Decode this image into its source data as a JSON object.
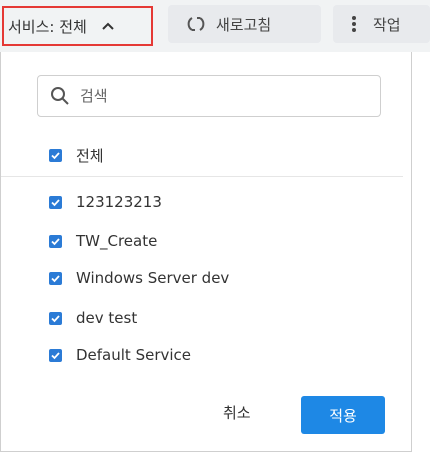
{
  "toolbar": {
    "service_filter_label": "서비스: 전체",
    "refresh_label": "새로고침",
    "actions_label": "작업"
  },
  "dropdown": {
    "search_placeholder": "검색",
    "select_all_label": "전체",
    "options": [
      {
        "label": "123123213",
        "checked": true
      },
      {
        "label": "TW_Create",
        "checked": true
      },
      {
        "label": "Windows Server dev",
        "checked": true
      },
      {
        "label": "dev test",
        "checked": true
      },
      {
        "label": "Default Service",
        "checked": true
      }
    ],
    "cancel_label": "취소",
    "apply_label": "적용"
  },
  "colors": {
    "accent": "#1e88e5",
    "checkbox": "#2b7bd6",
    "highlight_border": "#e53935"
  },
  "icons": [
    "chevron-up-icon",
    "refresh-icon",
    "more-vertical-icon",
    "search-icon",
    "checkbox-checked-icon"
  ]
}
